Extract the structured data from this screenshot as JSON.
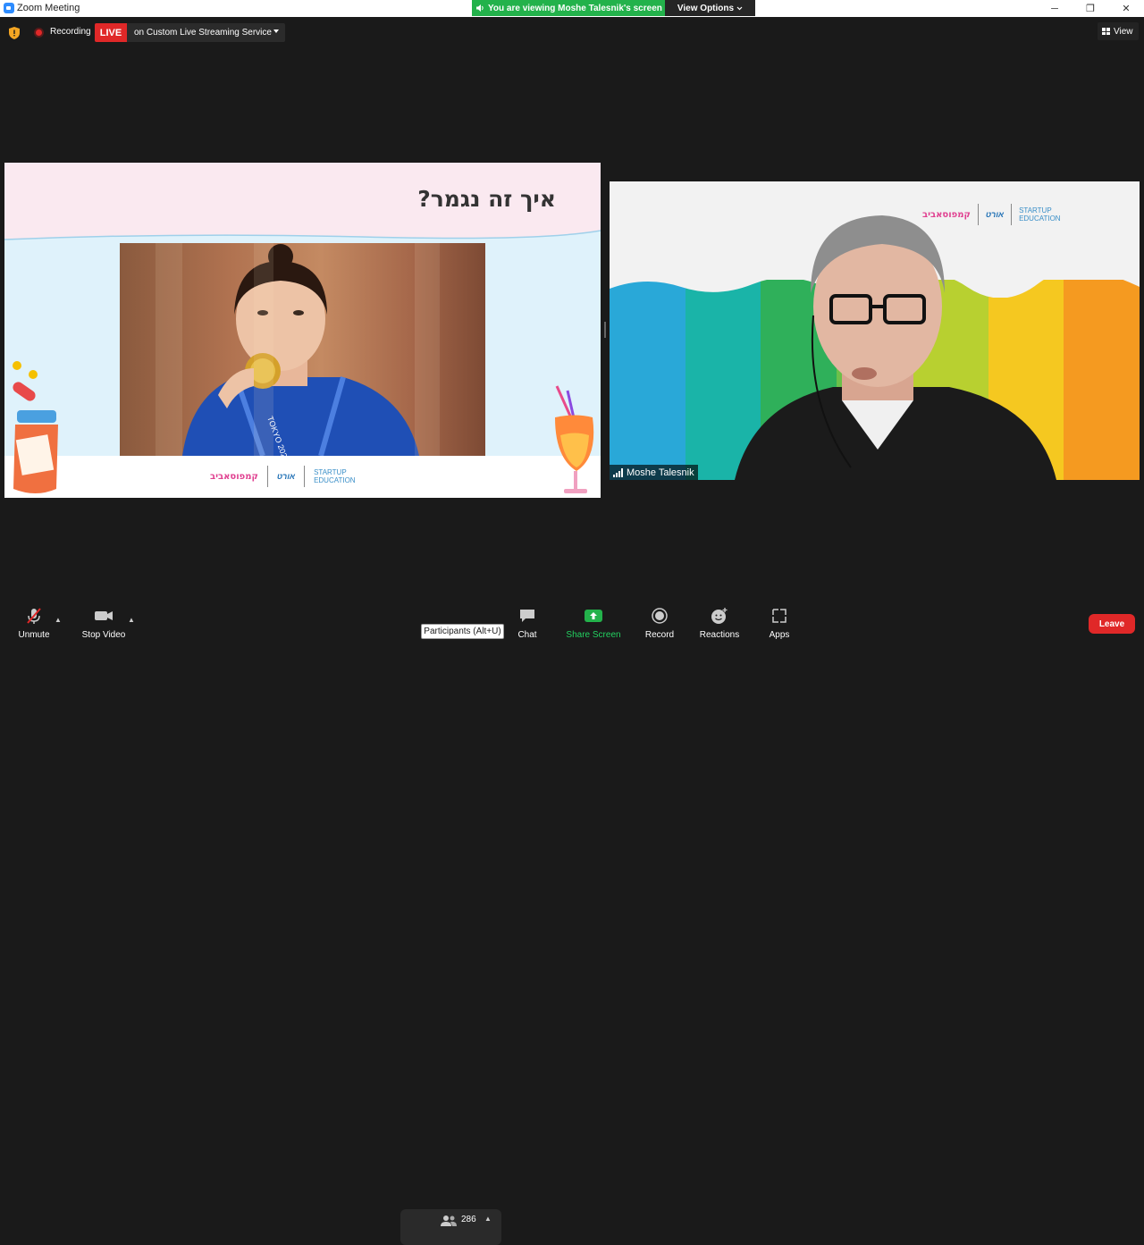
{
  "window": {
    "title": "Zoom Meeting",
    "controls": [
      "─",
      "❐",
      "✕"
    ]
  },
  "share_banner": {
    "text": "You are viewing Moshe Talesnik's screen",
    "view_options": "View Options"
  },
  "topbar": {
    "recording": "Recording",
    "live": "LIVE",
    "live_service": "on Custom Live Streaming Service",
    "view": "View"
  },
  "slide": {
    "title": "איך זה נגמר?",
    "logo_left": "קמפוסאביב",
    "logo_mid": "אורט",
    "logo_right": "STARTUP\nEDUCATION",
    "photo_text": "TOKYO 2020"
  },
  "video": {
    "participant_name": "Moshe Talesnik",
    "logo_left": "קמפוסאביב",
    "logo_mid": "אורט",
    "logo_right": "STARTUP\nEDUCATION"
  },
  "toolbar": {
    "unmute": "Unmute",
    "stop_video": "Stop Video",
    "participants_count": "286",
    "participants_tooltip": "Participants (Alt+U)",
    "chat": "Chat",
    "share_screen": "Share Screen",
    "record": "Record",
    "reactions": "Reactions",
    "apps": "Apps",
    "leave": "Leave"
  },
  "colors": {
    "share_green": "#23b24b",
    "live_red": "#e02828",
    "leave_red": "#e02828",
    "background": "#1a1a1a"
  }
}
